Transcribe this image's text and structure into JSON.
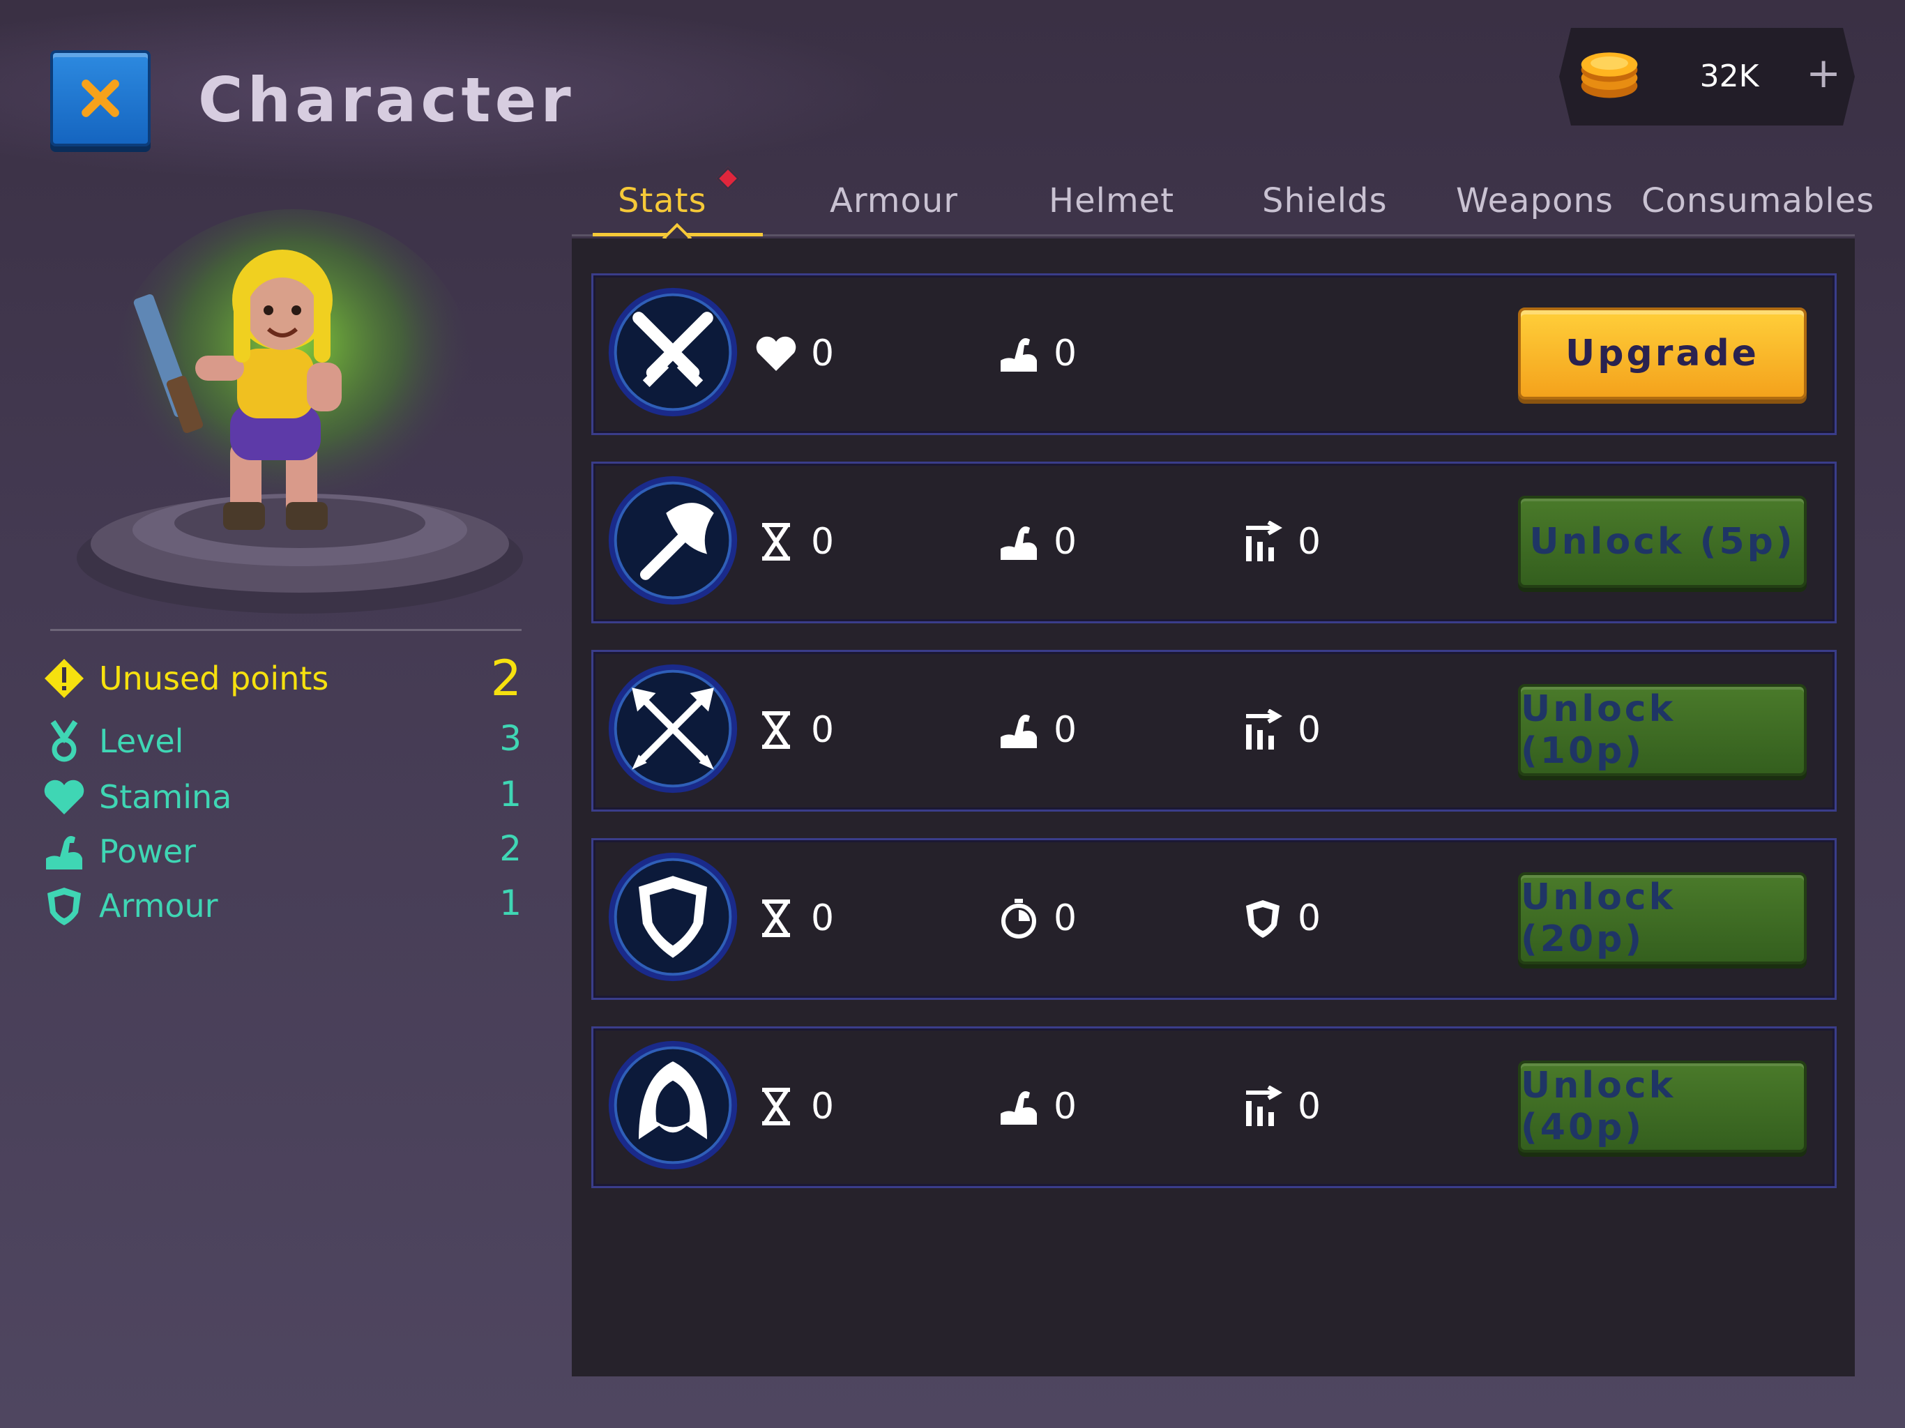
{
  "header": {
    "close_icon": "close-icon",
    "title": "Character",
    "coins": {
      "icon": "coin-stack-icon",
      "value": "32K",
      "add_label": "+"
    }
  },
  "tabs": [
    {
      "label": "Stats",
      "active": true,
      "notification": true
    },
    {
      "label": "Armour"
    },
    {
      "label": "Helmet"
    },
    {
      "label": "Shields"
    },
    {
      "label": "Weapons"
    },
    {
      "label": "Consumables"
    }
  ],
  "character_stats": {
    "unused_points": {
      "label": "Unused points",
      "value": "2",
      "icon": "warning-icon",
      "color": "#f6e10f"
    },
    "level": {
      "label": "Level",
      "value": "3",
      "icon": "medal-icon"
    },
    "stamina": {
      "label": "Stamina",
      "value": "1",
      "icon": "heart-icon"
    },
    "power": {
      "label": "Power",
      "value": "2",
      "icon": "muscle-icon"
    },
    "armour": {
      "label": "Armour",
      "value": "1",
      "icon": "shield-icon"
    },
    "stat_color": "#3fd6b4"
  },
  "skills": [
    {
      "icon": "crossed-swords-icon",
      "stats": [
        {
          "icon": "heart-icon",
          "value": "0"
        },
        {
          "icon": "muscle-icon",
          "value": "0"
        }
      ],
      "button": {
        "label": "Upgrade",
        "style": "upgrade"
      }
    },
    {
      "icon": "axe-icon",
      "stats": [
        {
          "icon": "hourglass-icon",
          "value": "0"
        },
        {
          "icon": "muscle-icon",
          "value": "0"
        },
        {
          "icon": "damage-bars-icon",
          "value": "0"
        }
      ],
      "button": {
        "label": "Unlock (5p)",
        "style": "locked"
      }
    },
    {
      "icon": "crossed-arrows-icon",
      "stats": [
        {
          "icon": "hourglass-icon",
          "value": "0"
        },
        {
          "icon": "muscle-icon",
          "value": "0"
        },
        {
          "icon": "damage-bars-icon",
          "value": "0"
        }
      ],
      "button": {
        "label": "Unlock (10p)",
        "style": "locked"
      }
    },
    {
      "icon": "shield-icon",
      "stats": [
        {
          "icon": "hourglass-icon",
          "value": "0"
        },
        {
          "icon": "stopwatch-icon",
          "value": "0"
        },
        {
          "icon": "small-shield-icon",
          "value": "0"
        }
      ],
      "button": {
        "label": "Unlock (20p)",
        "style": "locked"
      }
    },
    {
      "icon": "hood-icon",
      "stats": [
        {
          "icon": "hourglass-icon",
          "value": "0"
        },
        {
          "icon": "muscle-icon",
          "value": "0"
        },
        {
          "icon": "damage-bars-icon",
          "value": "0"
        }
      ],
      "button": {
        "label": "Unlock (40p)",
        "style": "locked"
      }
    }
  ]
}
